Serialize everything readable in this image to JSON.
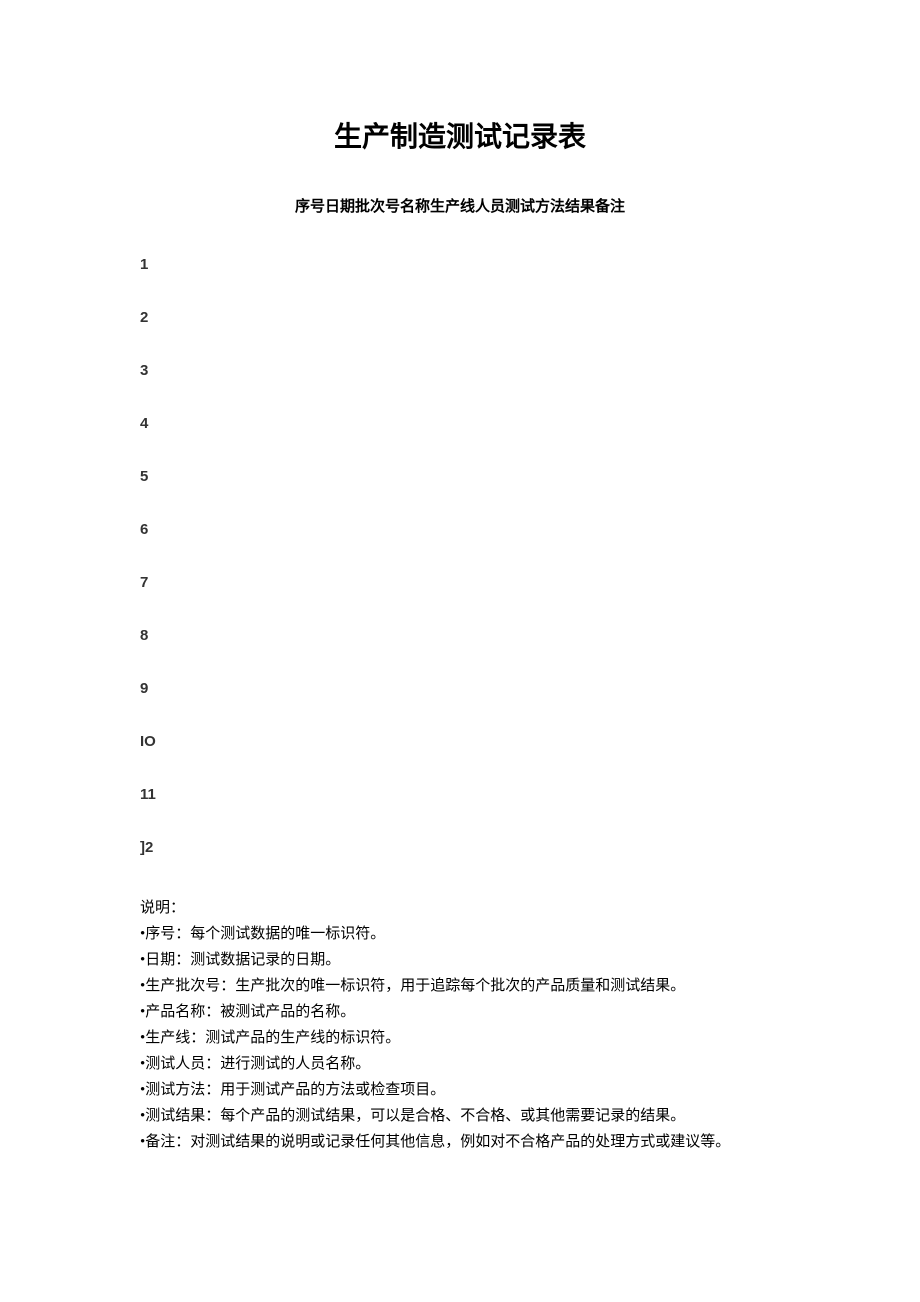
{
  "title": "生产制造测试记录表",
  "headerRow": "序号日期批次号名称生产线人员测试方法结果备注",
  "rows": [
    "1",
    "2",
    "3",
    "4",
    "5",
    "6",
    "7",
    "8",
    "9",
    "IO",
    "11",
    "]2"
  ],
  "explanation": {
    "title": "说明：",
    "items": [
      "序号：每个测试数据的唯一标识符。",
      "日期：测试数据记录的日期。",
      "生产批次号：生产批次的唯一标识符，用于追踪每个批次的产品质量和测试结果。",
      "产品名称：被测试产品的名称。",
      "生产线：测试产品的生产线的标识符。",
      "测试人员：进行测试的人员名称。",
      "测试方法：用于测试产品的方法或检查项目。",
      "测试结果：每个产品的测试结果，可以是合格、不合格、或其他需要记录的结果。",
      "备注：对测试结果的说明或记录任何其他信息，例如对不合格产品的处理方式或建议等。"
    ]
  }
}
